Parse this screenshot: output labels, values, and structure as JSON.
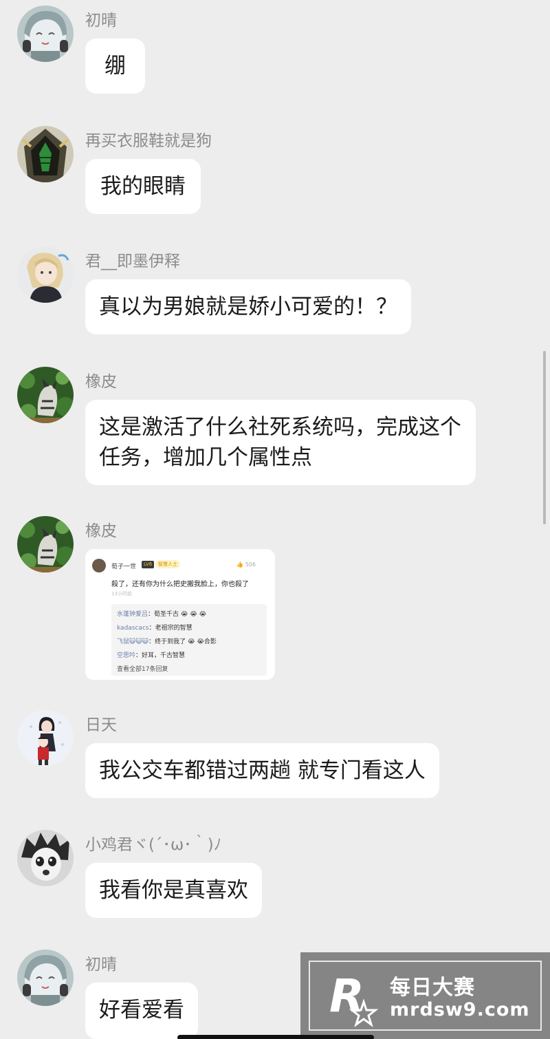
{
  "messages": [
    {
      "user": "初晴",
      "text": "绷",
      "avatar": "anime-girl-headphones-avatar"
    },
    {
      "user": "再买衣服鞋就是狗",
      "text": "我的眼睛",
      "avatar": "hooded-green-mask-avatar"
    },
    {
      "user": "君__即墨伊释",
      "text": "真以为男娘就是娇小可爱的！？",
      "avatar": "blonde-anime-girl-avatar"
    },
    {
      "user": "橡皮",
      "text": "这是激活了什么社死系统吗，完成这个任务，增加几个属性点",
      "avatar": "cat-in-leaves-avatar"
    },
    {
      "user": "橡皮",
      "avatar": "cat-in-leaves-avatar",
      "image": {
        "user": "荀子一世",
        "badge": "LV6",
        "badge2": "智慧人士",
        "likes": "506",
        "text": "殺了，还有你为什么把史搬我脸上，你也殺了",
        "time": "13小时前",
        "replies": [
          {
            "user": "水蓬钟爱吕",
            "text": "荀圣千古 😭 😭 😭"
          },
          {
            "user": "kadascacs",
            "text": "老祖宗的智慧"
          },
          {
            "user": "飞鼠😺😺😺",
            "text": "终于到我了 😭 😭合影"
          },
          {
            "user": "空思吟",
            "text": "好耳，千古智慧"
          }
        ],
        "more": "查看全部17条回复"
      }
    },
    {
      "user": "日天",
      "text": "我公交车都错过两趟 就专门看这人",
      "avatar": "couple-illustration-avatar"
    },
    {
      "user": "小鸡君ヾ(´･ω･｀)ﾉ",
      "text": "我看你是真喜欢",
      "avatar": "manga-face-avatar"
    },
    {
      "user": "初晴",
      "text": "好看爱看",
      "avatar": "anime-girl-headphones-avatar"
    }
  ],
  "watermark": {
    "brand": "每日大赛",
    "url": "mrdsw9.com",
    "logo_letter": "R"
  },
  "colors": {
    "background": "#ededed",
    "bubble": "#ffffff",
    "username": "#8c8c8c",
    "text": "#1b1b1b"
  }
}
